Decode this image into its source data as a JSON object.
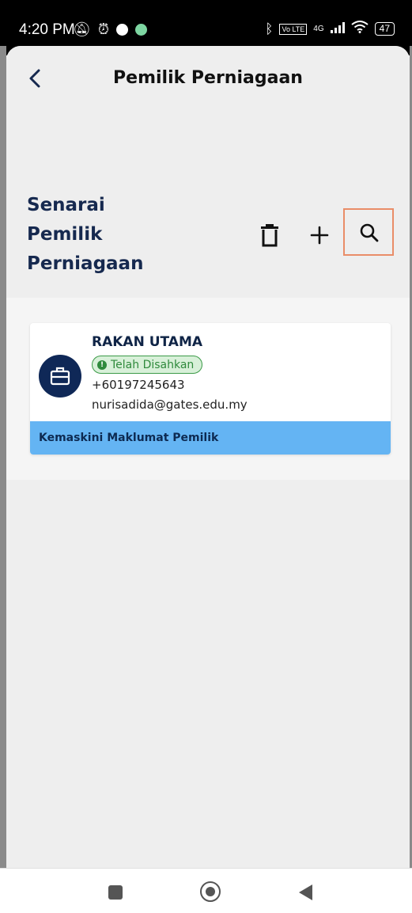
{
  "status_bar": {
    "time": "4:20 PM",
    "left_icons": [
      "mute-icon",
      "alarm-icon",
      "notification-dot-icon",
      "app-dot-icon"
    ],
    "right_icons": [
      "bluetooth-icon",
      "volte-icon",
      "signal-icon",
      "wifi-icon",
      "battery-icon"
    ],
    "volte_label": "Vo LTE",
    "network_label": "4G",
    "battery_level": "47"
  },
  "header": {
    "title": "Pemilik Perniagaan",
    "back_icon": "chevron-left-icon"
  },
  "section": {
    "title_lines": [
      "Senarai",
      "Pemilik",
      "Perniagaan"
    ],
    "actions": {
      "delete_icon": "trash-icon",
      "add_icon": "plus-icon",
      "search_icon": "search-icon"
    },
    "highlight_color": "#e98d68"
  },
  "owners": [
    {
      "name": "RAKAN UTAMA",
      "status": "Telah Disahkan",
      "phone": "+60197245643",
      "email": "nurisadida@gates.edu.my",
      "avatar_icon": "briefcase-icon",
      "action_label": "Kemaskini Maklumat Pemilik"
    }
  ],
  "colors": {
    "primary_dark": "#0f2857",
    "accent_blue": "#64b4f3",
    "verified_green": "#2f8a3c",
    "background": "#eeeeee"
  },
  "nav_bar": {
    "icons": [
      "recents-icon",
      "home-icon",
      "back-icon"
    ]
  }
}
